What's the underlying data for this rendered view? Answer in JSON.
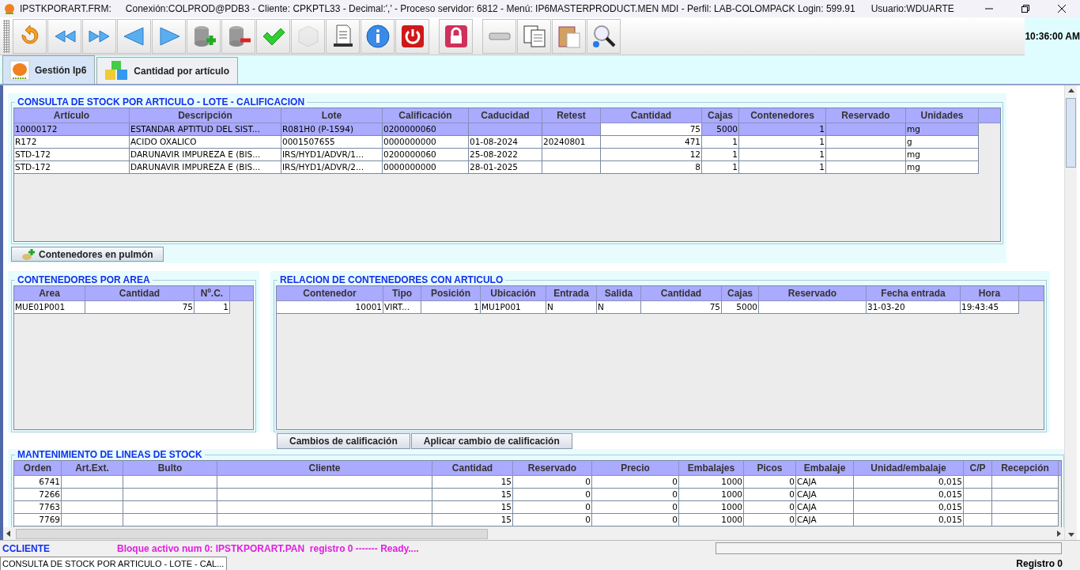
{
  "window": {
    "title": "IPSTKPORART.FRM:",
    "connection": "Conexión:COLPROD@PDB3 - Cliente: CPKPTL33 - Decimal:',' - Proceso servidor: 6812 - Menú: IP6MASTERPRODUCT.MEN MDI - Perfil: LAB-COLOMPACK Login: 599.91",
    "user": "Usuario:WDUARTE"
  },
  "toolbar": [
    [
      {
        "kind": "refresh",
        "disabled": false
      },
      {
        "kind": "rewind",
        "disabled": false
      },
      {
        "kind": "forward",
        "disabled": false
      },
      {
        "kind": "prev",
        "disabled": false
      },
      {
        "kind": "next",
        "disabled": false
      },
      {
        "kind": "db-add",
        "disabled": false
      },
      {
        "kind": "db-remove",
        "disabled": false
      },
      {
        "kind": "check",
        "disabled": false
      },
      {
        "kind": "cube",
        "disabled": true
      },
      {
        "kind": "print",
        "disabled": false
      },
      {
        "kind": "info",
        "disabled": false
      },
      {
        "kind": "power",
        "disabled": false
      }
    ],
    [
      {
        "kind": "lock",
        "disabled": false
      }
    ],
    [
      {
        "kind": "eraser",
        "disabled": false
      },
      {
        "kind": "copy",
        "disabled": false
      },
      {
        "kind": "paste",
        "disabled": false
      },
      {
        "kind": "zoom",
        "disabled": false
      }
    ]
  ],
  "clock": "10:36:00 AM",
  "tabs": [
    {
      "label": "Gestión Ip6",
      "selected": true,
      "kind": "logo"
    },
    {
      "label": "Cantidad por artículo",
      "selected": false,
      "kind": "cubes"
    }
  ],
  "stock_panel": {
    "title": "CONSULTA DE STOCK POR ARTICULO - LOTE - CALIFICACION",
    "columns": [
      "Artículo",
      "Descripción",
      "Lote",
      "Calificación",
      "Caducidad",
      "Retest",
      "Cantidad",
      "Cajas",
      "Contenedores",
      "Reservado",
      "Unidades"
    ],
    "rows": [
      {
        "selected": true,
        "cells": [
          "10000172",
          "ESTANDAR APTITUD DEL SIST...",
          "R081H0 (P-1594)",
          "0200000060",
          "",
          "",
          {
            "text": "75",
            "editing": true
          },
          "5000",
          "1",
          "",
          "mg"
        ]
      },
      {
        "selected": false,
        "cells": [
          "R172",
          "ACIDO OXALICO",
          "0001507655",
          "0000000000",
          "01-08-2024",
          "20240801",
          "471",
          "1",
          "1",
          "",
          "g"
        ]
      },
      {
        "selected": false,
        "cells": [
          "STD-172",
          "DARUNAVIR IMPUREZA E (BIS...",
          "IRS/HYD1/ADVR/1...",
          "0200000060",
          "25-08-2022",
          "",
          "12",
          "1",
          "1",
          "",
          "mg"
        ]
      },
      {
        "selected": false,
        "cells": [
          "STD-172",
          "DARUNAVIR IMPUREZA E (BIS...",
          "IRS/HYD1/ADVR/2...",
          "0000000000",
          "28-01-2025",
          "",
          "8",
          "1",
          "1",
          "",
          "mg"
        ]
      }
    ]
  },
  "pulmon_button": "Contenedores en pulmón",
  "area_panel": {
    "title": "CONTENEDORES POR AREA",
    "columns": [
      "Area",
      "Cantidad",
      "Nº.C."
    ],
    "rows": [
      {
        "selected": false,
        "cells": [
          "MUE01P001",
          "75",
          "1"
        ]
      }
    ]
  },
  "relation_panel": {
    "title": "RELACION DE CONTENEDORES CON ARTICULO",
    "columns": [
      "Contenedor",
      "Tipo",
      "Posición",
      "Ubicación",
      "Entrada",
      "Salida",
      "Cantidad",
      "Cajas",
      "Reservado",
      "Fecha entrada",
      "Hora"
    ],
    "rows": [
      {
        "selected": false,
        "cells": [
          "10001",
          "VIRT...",
          "1",
          "MU1P001",
          "N",
          "N",
          "75",
          "5000",
          "",
          "31-03-20",
          "19:43:45"
        ]
      }
    ]
  },
  "buttons": [
    "Cambios de calificación",
    "Aplicar cambio de calificación"
  ],
  "lines_panel": {
    "title": "MANTENIMIENTO DE LINEAS DE STOCK",
    "columns": [
      "Orden",
      "Art.Ext.",
      "Bulto",
      "Cliente",
      "Cantidad",
      "Reservado",
      "Precio",
      "Embalajes",
      "Picos",
      "Embalaje",
      "Unidad/embalaje",
      "C/P",
      "Recepción"
    ],
    "rows": [
      {
        "selected": false,
        "cells": [
          "6741",
          "",
          "",
          "",
          "15",
          "0",
          "0",
          "1000",
          "0",
          "CAJA",
          "0,015",
          "",
          ""
        ]
      },
      {
        "selected": false,
        "cells": [
          "7266",
          "",
          "",
          "",
          "15",
          "0",
          "0",
          "1000",
          "0",
          "CAJA",
          "0,015",
          "",
          ""
        ]
      },
      {
        "selected": false,
        "cells": [
          "7763",
          "",
          "",
          "",
          "15",
          "0",
          "0",
          "1000",
          "0",
          "CAJA",
          "0,015",
          "",
          ""
        ]
      },
      {
        "selected": false,
        "cells": [
          "7769",
          "",
          "",
          "",
          "15",
          "0",
          "0",
          "1000",
          "0",
          "CAJA",
          "0,015",
          "",
          ""
        ]
      }
    ]
  },
  "status_bar": {
    "field": "CCLIENTE",
    "message": "Bloque activo num 0: IPSTKPORART.PAN  registro 0 ------- Ready...."
  },
  "task_tab": "CONSULTA DE STOCK POR ARTICULO - LOTE - CAL...",
  "record": "Registro 0"
}
